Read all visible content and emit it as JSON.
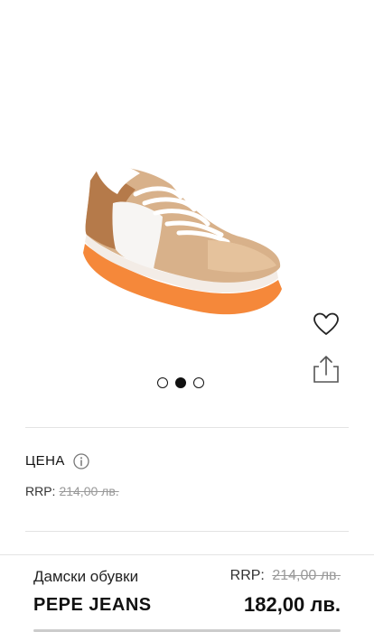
{
  "gallery": {
    "slide_count": 3,
    "active_slide": 2,
    "dots": [
      "slide-1",
      "slide-2",
      "slide-3"
    ]
  },
  "icons": {
    "wishlist": "heart-icon",
    "share": "share-icon",
    "info": "info-icon"
  },
  "price_section": {
    "label": "ЦЕНА",
    "rrp_label": "RRP:",
    "rrp_value": "214,00 лв."
  },
  "product_bar": {
    "category": "Дамски обувки",
    "brand": "PEPE JEANS",
    "rrp_label": "RRP:",
    "rrp_value": "214,00 лв.",
    "price": "182,00 лв."
  },
  "colors": {
    "accent_orange": "#f5883a",
    "gold": "#d8b18a",
    "text": "#111111",
    "divider": "#e3e3e3"
  }
}
